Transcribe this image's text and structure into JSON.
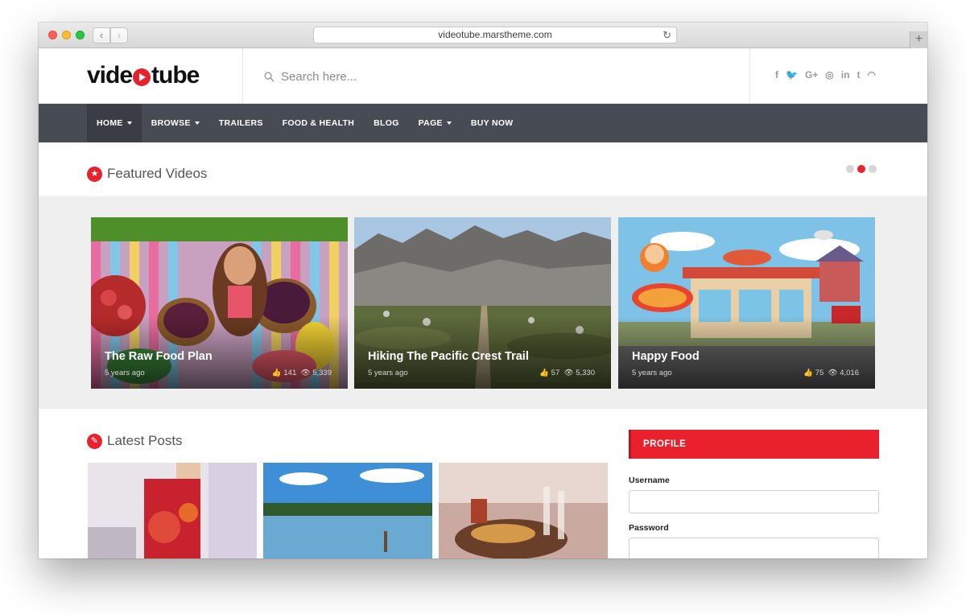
{
  "browser": {
    "url": "videotube.marstheme.com",
    "back_glyph": "‹",
    "forward_glyph": "›",
    "reload_glyph": "↻",
    "new_tab_glyph": "+"
  },
  "site": {
    "logo_prefix": "vide",
    "logo_suffix": "tube",
    "logo_accent_color": "#e8212d"
  },
  "search": {
    "placeholder": "Search here..."
  },
  "social": [
    {
      "icon": "facebook-icon",
      "glyph": "f"
    },
    {
      "icon": "twitter-icon",
      "glyph": "🐦"
    },
    {
      "icon": "google-plus-icon",
      "glyph": "G+"
    },
    {
      "icon": "instagram-icon",
      "glyph": "◎"
    },
    {
      "icon": "linkedin-icon",
      "glyph": "in"
    },
    {
      "icon": "tumblr-icon",
      "glyph": "t"
    },
    {
      "icon": "rss-icon",
      "glyph": "◠"
    }
  ],
  "nav": {
    "items": [
      {
        "label": "HOME",
        "dropdown": true,
        "active": true
      },
      {
        "label": "BROWSE",
        "dropdown": true,
        "active": false
      },
      {
        "label": "TRAILERS",
        "dropdown": false,
        "active": false
      },
      {
        "label": "FOOD & HEALTH",
        "dropdown": false,
        "active": false
      },
      {
        "label": "BLOG",
        "dropdown": false,
        "active": false
      },
      {
        "label": "PAGE",
        "dropdown": true,
        "active": false
      },
      {
        "label": "BUY NOW",
        "dropdown": false,
        "active": false
      }
    ]
  },
  "featured": {
    "title": "Featured Videos",
    "slider_dots": 3,
    "active_dot": 2,
    "videos": [
      {
        "title": "The Raw Food Plan",
        "date": "5 years ago",
        "likes": "141",
        "views": "5,339"
      },
      {
        "title": "Hiking The Pacific Crest Trail",
        "date": "5 years ago",
        "likes": "57",
        "views": "5,330"
      },
      {
        "title": "Happy Food",
        "date": "5 years ago",
        "likes": "75",
        "views": "4,016"
      }
    ]
  },
  "latest": {
    "title": "Latest Posts"
  },
  "profile": {
    "header": "PROFILE",
    "username_label": "Username",
    "password_label": "Password"
  },
  "colors": {
    "accent": "#e8212d",
    "nav_bg": "#474c54"
  }
}
